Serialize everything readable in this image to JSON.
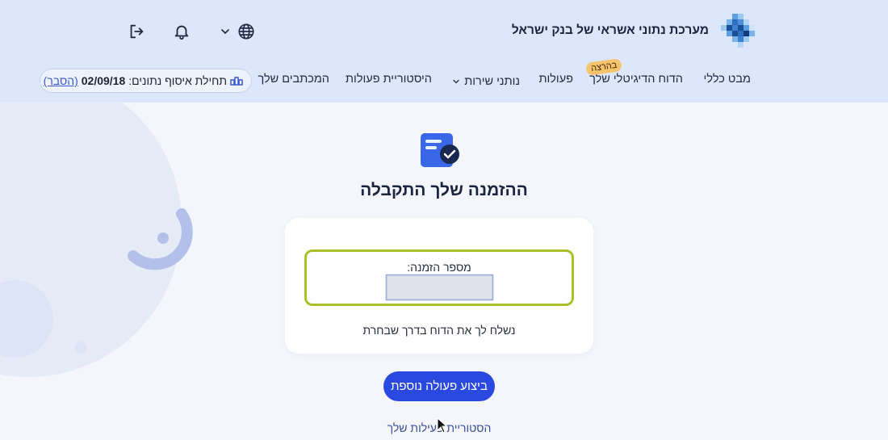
{
  "header": {
    "brand": "מערכת נתוני אשראי של בנק ישראל",
    "icons": {
      "logout": "logout-icon",
      "notifications": "bell-icon",
      "language": "globe-icon",
      "language_dropdown": "chevron-down-icon"
    }
  },
  "nav": {
    "items": [
      {
        "label": "מבט כללי"
      },
      {
        "label": "הדוח הדיגיטלי שלך",
        "badge": "בהרצה"
      },
      {
        "label": "פעולות"
      },
      {
        "label": "נותני שירות",
        "has_dropdown": true
      },
      {
        "label": "היסטוריית פעולות"
      },
      {
        "label": "המכתבים שלך"
      }
    ],
    "data_collection": {
      "label": "תחילת איסוף נתונים:",
      "date": "02/09/18",
      "explain": "(הסבר)"
    }
  },
  "confirmation": {
    "title": "ההזמנה שלך התקבלה",
    "order_label": "מספר הזמנה:",
    "order_value": "",
    "note": "נשלח לך את הדוח בדרך שבחרת"
  },
  "actions": {
    "primary": "ביצוע פעולה נוספת",
    "history_link": "הסטוריית פעילות שלך"
  },
  "colors": {
    "header_bg": "#dde7fb",
    "primary": "#2a49e0",
    "highlight": "#a8c12a",
    "badge": "#f7c46b"
  }
}
